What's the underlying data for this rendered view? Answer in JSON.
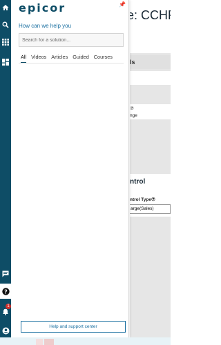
{
  "rail": {
    "notification_count": "1"
  },
  "panel": {
    "logo": "epicor",
    "help_title": "How can we help you",
    "search_placeholder": "Search for a solution...",
    "tabs": [
      {
        "label": "All",
        "active": true
      },
      {
        "label": "Videos",
        "active": false
      },
      {
        "label": "Articles",
        "active": false
      },
      {
        "label": "Guided",
        "active": false
      },
      {
        "label": "Courses",
        "active": false
      }
    ],
    "support_button": "Help and support center"
  },
  "background_page": {
    "title_fragment": "e: CCHR",
    "section1_fragment": "ls",
    "label1_fragment": "nge",
    "section2_fragment": "ntrol",
    "label2_fragment": "ntrol Type",
    "field_value_fragment": "arge(Sales)"
  },
  "colors": {
    "rail": "#0e4d66",
    "accent": "#1a6fa0",
    "badge": "#d0312d"
  }
}
